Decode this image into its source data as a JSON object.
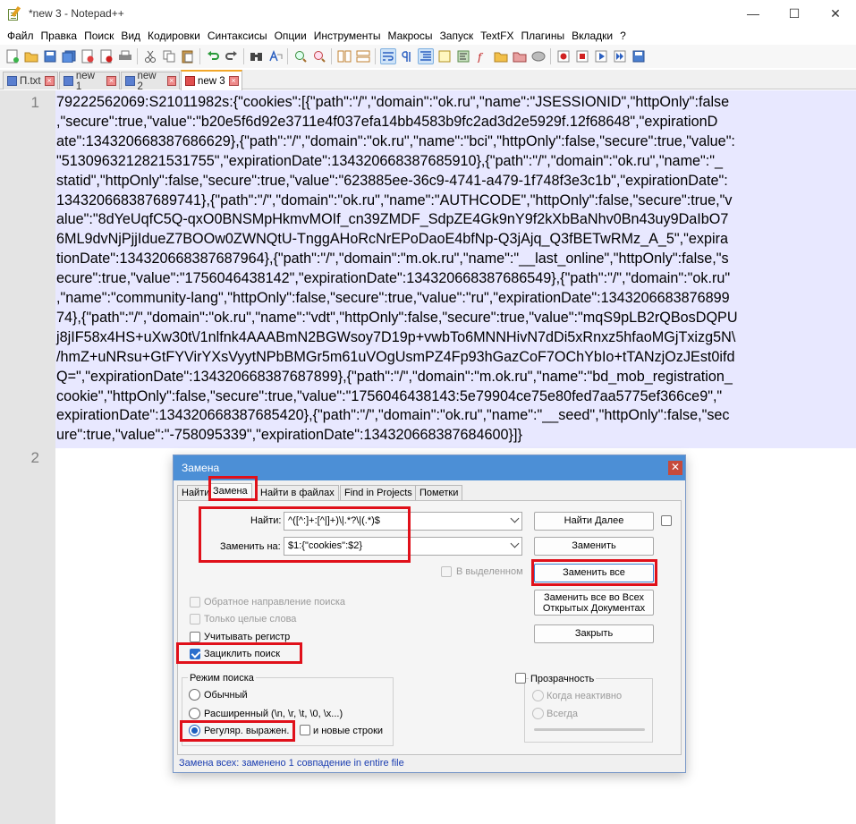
{
  "window": {
    "title": "*new 3 - Notepad++",
    "minimize": "—",
    "maximize": "☐",
    "close": "✕"
  },
  "menu": [
    "Файл",
    "Правка",
    "Поиск",
    "Вид",
    "Кодировки",
    "Синтаксисы",
    "Опции",
    "Инструменты",
    "Макросы",
    "Запуск",
    "TextFX",
    "Плагины",
    "Вкладки",
    "?"
  ],
  "tabs": [
    {
      "label": "П.txt",
      "active": false
    },
    {
      "label": "new 1",
      "active": false
    },
    {
      "label": "new 2",
      "active": false
    },
    {
      "label": "new 3",
      "active": true
    }
  ],
  "editor": {
    "line_numbers": [
      "1",
      "2"
    ],
    "line1_wrapped": [
      "79222562069:S21011982s:{\"cookies\":[{\"path\":\"/\",\"domain\":\"ok.ru\",\"name\":\"JSESSIONID\",\"httpOnly\":false",
      ",\"secure\":true,\"value\":\"b20e5f6d92e3711e4f037efa14bb4583b9fc2ad3d2e5929f.12f68648\",\"expirationD",
      "ate\":134320668387686629},{\"path\":\"/\",\"domain\":\"ok.ru\",\"name\":\"bci\",\"httpOnly\":false,\"secure\":true,\"value\":",
      "\"5130963212821531755\",\"expirationDate\":134320668387685910},{\"path\":\"/\",\"domain\":\"ok.ru\",\"name\":\"_",
      "statid\",\"httpOnly\":false,\"secure\":true,\"value\":\"623885ee-36c9-4741-a479-1f748f3e3c1b\",\"expirationDate\":",
      "134320668387689741},{\"path\":\"/\",\"domain\":\"ok.ru\",\"name\":\"AUTHCODE\",\"httpOnly\":false,\"secure\":true,\"v",
      "alue\":\"8dYeUqfC5Q-qxO0BNSMpHkmvMOIf_cn39ZMDF_SdpZE4Gk9nY9f2kXbBaNhv0Bn43uy9DaIbO7",
      "6ML9dvNjPjjIdueZ7BOOw0ZWNQtU-TnggAHoRcNrEPoDaoE4bfNp-Q3jAjq_Q3fBETwRMz_A_5\",\"expira",
      "tionDate\":134320668387687964},{\"path\":\"/\",\"domain\":\"m.ok.ru\",\"name\":\"__last_online\",\"httpOnly\":false,\"s",
      "ecure\":true,\"value\":\"1756046438142\",\"expirationDate\":134320668387686549},{\"path\":\"/\",\"domain\":\"ok.ru\"",
      ",\"name\":\"community-lang\",\"httpOnly\":false,\"secure\":true,\"value\":\"ru\",\"expirationDate\":1343206683876899",
      "74},{\"path\":\"/\",\"domain\":\"ok.ru\",\"name\":\"vdt\",\"httpOnly\":false,\"secure\":true,\"value\":\"mqS9pLB2rQBosDQPU",
      "j8jIF58x4HS+uXw30t\\/1nlfnk4AAABmN2BGWsoy7D19p+vwbTo6MNNHivN7dDi5xRnxz5hfaoMGjTxizg5N\\",
      "/hmZ+uNRsu+GtFYVirYXsVyytNPbBMGr5m61uVOgUsmPZ4Fp93hGazCoF7OChYbIo+tTANzjOzJEst0ifd",
      "Q=\",\"expirationDate\":134320668387687899},{\"path\":\"/\",\"domain\":\"m.ok.ru\",\"name\":\"bd_mob_registration_",
      "cookie\",\"httpOnly\":false,\"secure\":true,\"value\":\"1756046438143:5e79904ce75e80fed7aa5775ef366ce9\",\"",
      "expirationDate\":134320668387685420},{\"path\":\"/\",\"domain\":\"ok.ru\",\"name\":\"__seed\",\"httpOnly\":false,\"sec",
      "ure\":true,\"value\":\"-758095339\",\"expirationDate\":134320668387684600}]}"
    ]
  },
  "dialog": {
    "title": "Замена",
    "close": "✕",
    "tabs": [
      "Найти",
      "Замена",
      "Найти в файлах",
      "Find in Projects",
      "Пометки"
    ],
    "find_label": "Найти:",
    "find_value": "^([^:]+:[^|]+)\\|.*?\\|(.*)$",
    "replace_label": "Заменить на:",
    "replace_value": "$1:{\"cookies\":$2}",
    "in_selection": "В выделенном",
    "buttons": {
      "find_next": "Найти Далее",
      "replace": "Заменить",
      "replace_all": "Заменить все",
      "replace_all_open_1": "Заменить все во Всех",
      "replace_all_open_2": "Открытых Документах",
      "close": "Закрыть"
    },
    "options": {
      "backward": "Обратное направление поиска",
      "whole_word": "Только целые слова",
      "match_case": "Учитывать регистр",
      "wrap": "Зациклить поиск"
    },
    "search_mode": {
      "title": "Режим поиска",
      "normal": "Обычный",
      "extended": "Расширенный (\\n, \\r, \\t, \\0, \\x...)",
      "regex": "Регуляр. выражен.",
      "newline": "и новые строки"
    },
    "transparency": {
      "title": "Прозрачность",
      "on_lose_focus": "Когда неактивно",
      "always": "Всегда"
    },
    "status": "Замена всех: заменено 1 совпадение in entire file"
  },
  "colors": {
    "highlight": "#e0101a",
    "line_highlight": "#e8e8ff",
    "status_text": "#1a3db0",
    "dialog_title": "#4c8fd6"
  }
}
